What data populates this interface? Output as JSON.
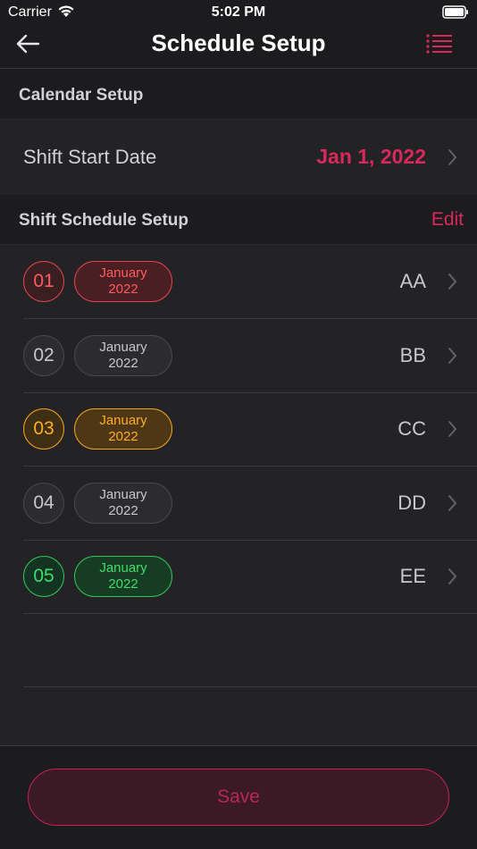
{
  "status_bar": {
    "carrier": "Carrier",
    "time": "5:02 PM"
  },
  "nav": {
    "title": "Schedule Setup",
    "back_icon": "arrow-left-icon",
    "menu_icon": "list-icon"
  },
  "calendar_setup": {
    "title": "Calendar Setup",
    "start_date_label": "Shift Start Date",
    "start_date_value": "Jan 1, 2022"
  },
  "shift_schedule": {
    "title": "Shift Schedule Setup",
    "edit_label": "Edit",
    "rows": [
      {
        "num": "01",
        "month": "January",
        "year": "2022",
        "code": "AA",
        "color": "#ff5a5f"
      },
      {
        "num": "02",
        "month": "January",
        "year": "2022",
        "code": "BB",
        "color": "#c7c7cc"
      },
      {
        "num": "03",
        "month": "January",
        "year": "2022",
        "code": "CC",
        "color": "#ffad1f"
      },
      {
        "num": "04",
        "month": "January",
        "year": "2022",
        "code": "DD",
        "color": "#c7c7cc"
      },
      {
        "num": "05",
        "month": "January",
        "year": "2022",
        "code": "EE",
        "color": "#3edc6a"
      }
    ]
  },
  "save_label": "Save",
  "colors": {
    "accent": "#d8285c",
    "background": "#1c1c1e",
    "row_background": "#232325"
  }
}
